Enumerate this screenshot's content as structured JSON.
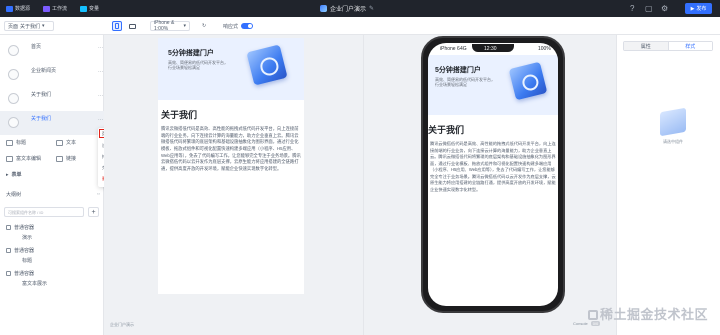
{
  "topbar": {
    "items": [
      {
        "label": "数据源",
        "color": "#3370ff"
      },
      {
        "label": "工作流",
        "color": "#7c5cff"
      },
      {
        "label": "变量",
        "color": "#14c0ff"
      }
    ],
    "app_title": "企业门户演示",
    "edit_icon": "✎",
    "publish_label": "发布"
  },
  "toolbar": {
    "page_prefix": "页面",
    "page_value": "关于我们",
    "device_value": "iPhone & 1:00%",
    "responsive_label": "响应式"
  },
  "pages": [
    {
      "name": "首页",
      "active": false
    },
    {
      "name": "企业新闻页",
      "active": false
    },
    {
      "name": "关于我们",
      "active": false
    },
    {
      "name": "关于我们",
      "active": true
    }
  ],
  "components": [
    {
      "label": "标题"
    },
    {
      "label": "文本"
    },
    {
      "label": "富文本编辑"
    },
    {
      "label": "链接"
    }
  ],
  "section_label": "表单",
  "outline": {
    "title": "大纲树",
    "search_placeholder": "可搜索组件名称 / ID",
    "nodes": [
      "普通容器",
      "演示",
      "普通容器",
      "标题",
      "普通容器",
      "富文本展示"
    ]
  },
  "context_menu": [
    "页面设置",
    "设为首页",
    "拷贝页面ID",
    "克隆",
    "删除"
  ],
  "preview": {
    "banner_title": "5分钟搭建门户",
    "banner_sub": "高效、简便易的低代码开发平台，行业场景轻松满足",
    "page_title": "关于我们",
    "body": "腾讯云微搭低代码是高效、高性能的拖拽式低代码开发平台，向上连接前端的行业业务，向下连接云计算的海量能力，助力企业垂直上云。腾讯云微搭低代码将繁琐的底层架构和基础设施抽象化为图形界面，通过行业化模板、拖放式组件和可视化配置快速构建多端应用（小程序、H5应用、Web应用等），免去了代码编写工作，让您能够完全专注于业务场景。腾讯云微搭低代码以云开发作为底层支撑，云原生能力将应用搭建的全链路打通，提供高度开放的开发环境，赋能企业快速实现数字化转型。"
  },
  "phone": {
    "carrier": "iPhone 6",
    "time": "4G",
    "clock": "12:30",
    "battery": "100%"
  },
  "footer": {
    "left_label": "企业门户演示",
    "console_label": "Console",
    "console_count": "0/0"
  },
  "right_panel": {
    "tab_props": "属性",
    "tab_style": "样式",
    "empty_text": "请选中组件"
  },
  "watermark": "稀土掘金技术社区"
}
